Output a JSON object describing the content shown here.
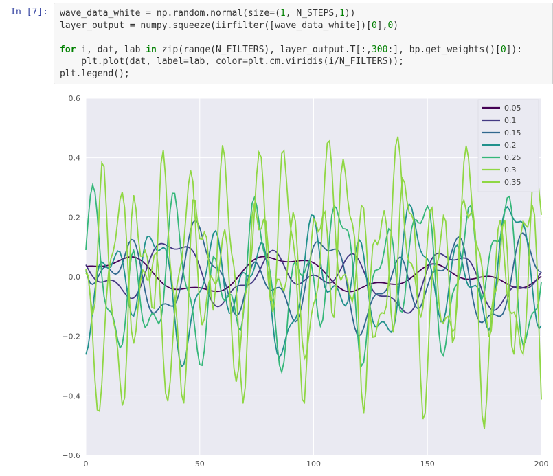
{
  "prompt": "In [7]:",
  "code": {
    "line1a": "wave_data_white = np.random.normal(size=(",
    "line1b": ", N_STEPS,",
    "line1c": "))",
    "num1a": "1",
    "num1b": "1",
    "line2a": "layer_output = numpy.squeeze(iirfilter([wave_data_white])[",
    "line2b": "],",
    "line2c": ")",
    "num2a": "0",
    "num2b": "0",
    "blank": "",
    "kw_for": "for",
    "kw_in": "in",
    "line3a": " i, dat, lab ",
    "line3b": " zip(range(N_FILTERS), layer_output.T[:,",
    "line3c": ":], bp.get_weights()[",
    "line3d": "]):",
    "num3a": "300",
    "num3b": "0",
    "line4": "    plt.plot(dat, label=lab, color=plt.cm.viridis(i/N_FILTERS));",
    "line5": "plt.legend();"
  },
  "chart_data": {
    "type": "line",
    "xlim": [
      0,
      200
    ],
    "ylim": [
      -0.6,
      0.6
    ],
    "xticks": [
      0,
      50,
      100,
      150,
      200
    ],
    "yticks": [
      -0.6,
      -0.4,
      -0.2,
      0.0,
      0.2,
      0.4,
      0.6
    ],
    "xtick_labels": [
      "0",
      "50",
      "100",
      "150",
      "200"
    ],
    "ytick_labels": [
      "−0.6",
      "−0.4",
      "−0.2",
      "0.0",
      "0.2",
      "0.4",
      "0.6"
    ],
    "legend_labels": [
      "0.05",
      "0.1",
      "0.15",
      "0.2",
      "0.25",
      "0.3",
      "0.35"
    ],
    "colors": [
      "#440154",
      "#443a83",
      "#31688e",
      "#21918c",
      "#35b779",
      "#90d743",
      "#8fd744"
    ],
    "amplitudes": [
      0.07,
      0.12,
      0.18,
      0.25,
      0.3,
      0.38,
      0.45
    ],
    "frequencies": [
      3,
      5,
      7,
      9,
      11,
      13,
      15
    ]
  }
}
